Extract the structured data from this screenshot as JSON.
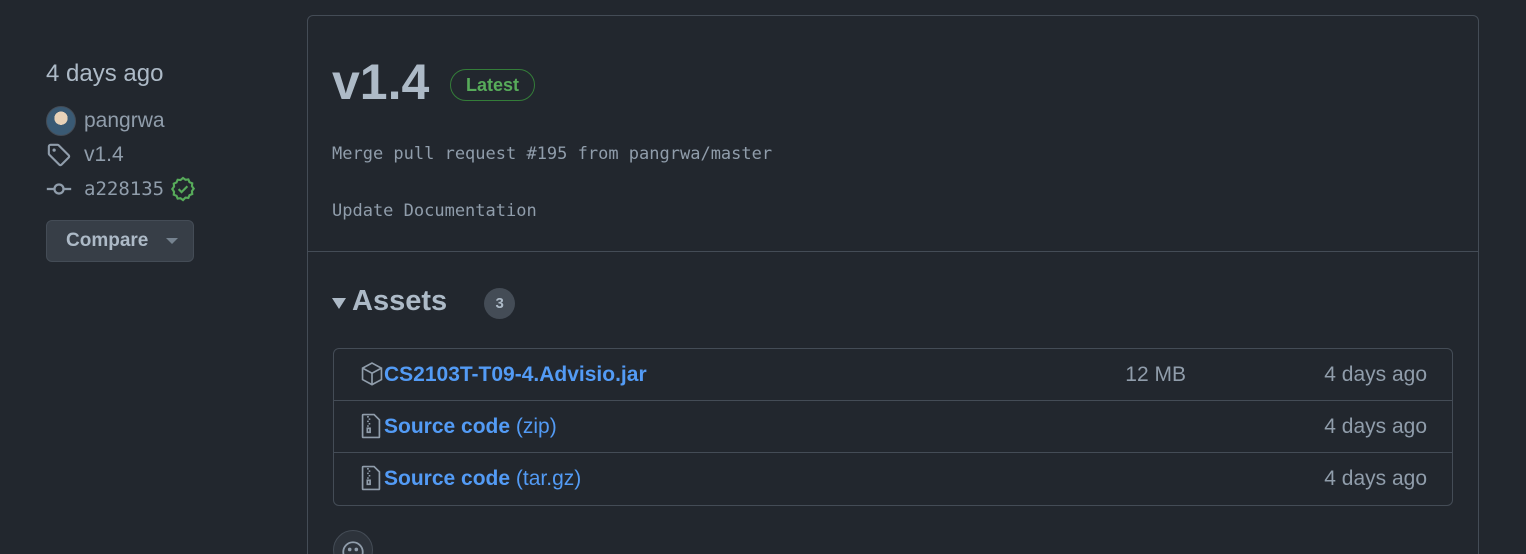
{
  "meta": {
    "date": "4 days ago",
    "author": "pangrwa",
    "tag": "v1.4",
    "commit": "a228135",
    "compare_label": "Compare"
  },
  "release": {
    "title": "v1.4",
    "badge": "Latest",
    "message_line1": "Merge pull request #195 from pangrwa/master",
    "message_line2": "Update Documentation"
  },
  "assets": {
    "title": "Assets",
    "count": "3",
    "items": [
      {
        "name": "CS2103T-T09-4.Advisio.jar",
        "suffix": "",
        "size": "12 MB",
        "date": "4 days ago",
        "icon": "package-icon"
      },
      {
        "name": "Source code",
        "suffix": "(zip)",
        "size": "",
        "date": "4 days ago",
        "icon": "file-zip-icon"
      },
      {
        "name": "Source code",
        "suffix": "(tar.gz)",
        "size": "",
        "date": "4 days ago",
        "icon": "file-zip-icon"
      }
    ]
  },
  "colors": {
    "background": "#22272e",
    "link": "#539bf5",
    "success": "#57ab5a",
    "border": "#444c56"
  }
}
